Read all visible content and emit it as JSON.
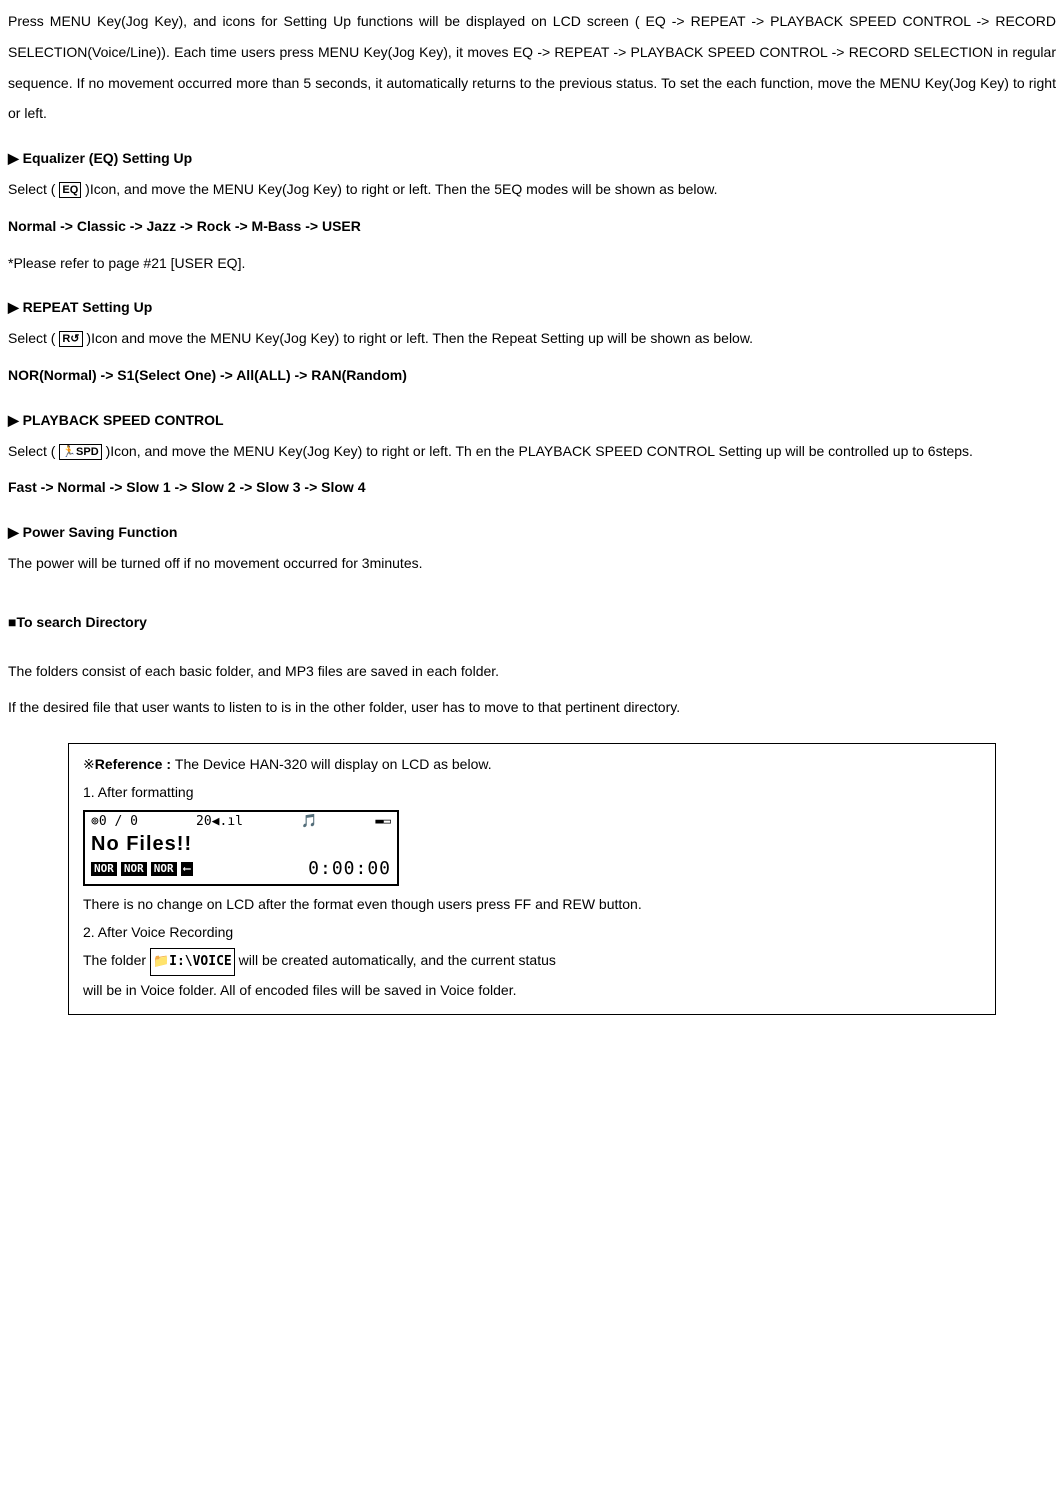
{
  "intro": "Press MENU Key(Jog Key),  and icons for Setting Up functions will be displayed on LCD screen ( EQ -> REPEAT  -> PLAYBACK SPEED CONTROL -> RECORD SELECTION(Voice/Line)).  Each time users press MENU Key(Jog Key), it moves EQ  -> REPEAT  -> PLAYBACK SPEED CONTROL  -> RECORD SELECTION in regular sequence.  If no movement occurred more than 5 seconds, it automatically returns to the previous status.  To set the each function, move the MENU Key(Jog Key) to right or left.",
  "eq": {
    "heading": "Equalizer (EQ) Setting Up",
    "select_pre": "Select ( ",
    "icon": "EQ",
    "select_post": " )Icon, and move the MENU Key(Jog Key) to right or left. Then the 5EQ modes will be shown as below.",
    "modes": "Normal -> Classic -> Jazz -> Rock -> M-Bass -> USER",
    "note": "*Please refer to page #21 [USER EQ]."
  },
  "repeat": {
    "heading": "REPEAT Setting Up",
    "select_pre": "Select ( ",
    "icon": "R↺",
    "select_post": " )Icon and move the MENU Key(Jog Key) to right or left. Then the Repeat Setting up will be shown as below.",
    "modes": "NOR(Normal) -> S1(Select One) -> All(ALL) -> RAN(Random)"
  },
  "speed": {
    "heading": "PLAYBACK SPEED CONTROL",
    "select_pre": "Select ( ",
    "icon": "🏃SPD",
    "select_post": " )Icon, and move the MENU Key(Jog Key) to right or left. Th en the PLAYBACK SPEED CONTROL Setting up will be controlled up to 6steps.",
    "modes": "Fast -> Normal -> Slow 1  -> Slow 2  -> Slow 3  -> Slow 4"
  },
  "power": {
    "heading": "Power Saving Function",
    "text": "The power will be turned off if no movement occurred for 3minutes."
  },
  "dir": {
    "heading": "To search Directory",
    "p1": "The folders consist of each basic folder, and MP3 files are saved in each folder.",
    "p2": "If the desired file that user wants to listen to is in the other folder, user has to move to that pertinent directory."
  },
  "ref": {
    "title_pre": "※",
    "title_bold": "Reference : ",
    "title_post": "The Device HAN-320 will display on LCD as below.",
    "item1": "1. After formatting",
    "lcd": {
      "top_left": "⊚0 / 0",
      "top_mid": "20◀.ıl",
      "top_icon": "🎵",
      "top_batt": "▬▭",
      "big": "No Files!!",
      "badge": "NOR",
      "arrow": "⟵",
      "time": "0:00:00"
    },
    "item1_after": "There is no change on LCD after the format even though users press FF and REW button.",
    "item2": "2. After Voice Recording",
    "item2_line_pre": "The folder ",
    "voice_icon": "📁I:\\VOICE",
    "item2_line_post": " will be created automatically, and the current status",
    "item2_line2": "will be in Voice folder. All of encoded files will be saved in Voice folder."
  }
}
